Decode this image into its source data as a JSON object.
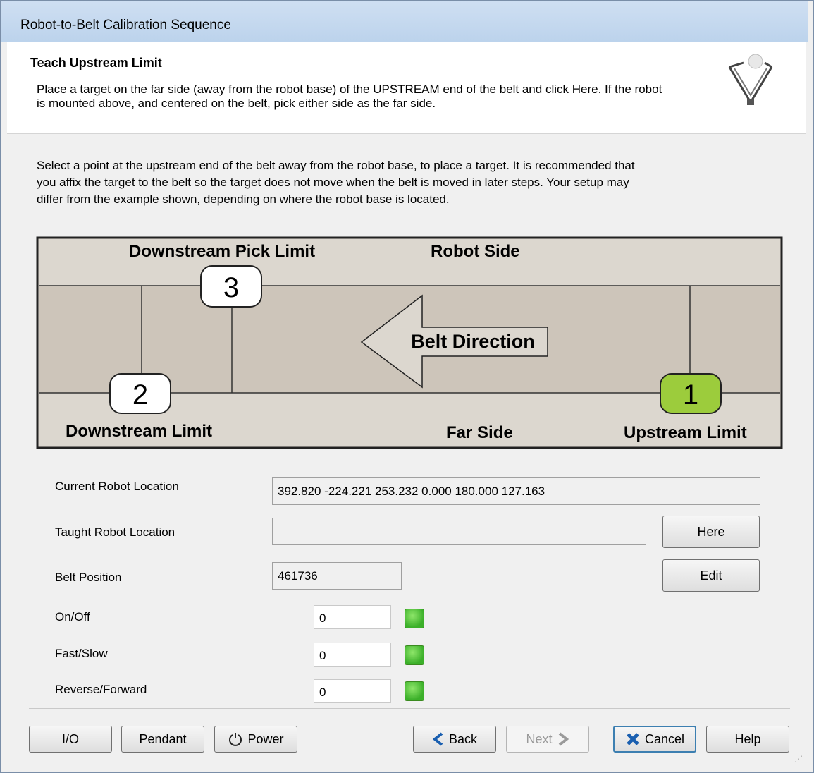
{
  "window": {
    "title": "Robot-to-Belt Calibration Sequence"
  },
  "header": {
    "title": "Teach Upstream Limit",
    "description": "Place a target on the far side (away from the robot base) of the UPSTREAM end of the belt and click Here.  If the robot is mounted above, and centered on the belt, pick either side as the far side."
  },
  "instructions": "Select a point at the upstream end of the belt away from the robot base, to place a target. It is recommended that you affix the target to the belt so the target does not move when the belt is moved in later steps. Your setup may differ from the example shown, depending on where the robot base is located.",
  "diagram": {
    "downstream_pick_limit": "Downstream Pick Limit",
    "robot_side": "Robot Side",
    "belt_direction": "Belt Direction",
    "downstream_limit": "Downstream Limit",
    "far_side": "Far Side",
    "upstream_limit": "Upstream Limit",
    "marker_1": "1",
    "marker_2": "2",
    "marker_3": "3",
    "highlight_color": "#9ccc3c"
  },
  "form": {
    "current_location_label": "Current Robot Location",
    "current_location_value": "392.820 -224.221 253.232 0.000 180.000 127.163",
    "taught_location_label": "Taught Robot Location",
    "taught_location_value": "",
    "belt_position_label": "Belt Position",
    "belt_position_value": "461736",
    "on_off_label": "On/Off",
    "on_off_value": "0",
    "fast_slow_label": "Fast/Slow",
    "fast_slow_value": "0",
    "reverse_forward_label": "Reverse/Forward",
    "reverse_forward_value": "0",
    "here_button": "Here",
    "edit_button": "Edit",
    "led_color": "#3cb02a"
  },
  "footer": {
    "io": "I/O",
    "pendant": "Pendant",
    "power": "Power",
    "back": "Back",
    "next": "Next",
    "cancel": "Cancel",
    "help": "Help"
  }
}
